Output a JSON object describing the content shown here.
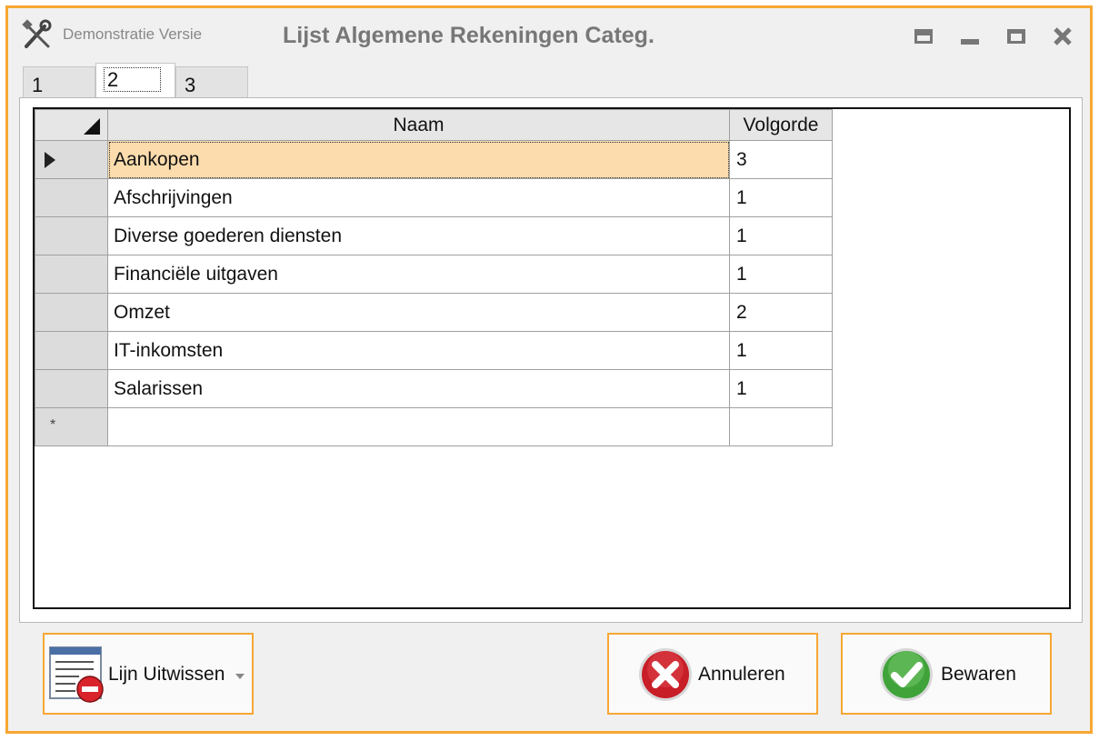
{
  "window": {
    "demo_label": "Demonstratie Versie",
    "title": "Lijst Algemene Rekeningen Categ."
  },
  "tabs": [
    {
      "label": "1"
    },
    {
      "label": "2",
      "active": true
    },
    {
      "label": "3"
    }
  ],
  "grid": {
    "columns": [
      "Naam",
      "Volgorde"
    ],
    "rows": [
      {
        "name": "Aankopen",
        "order": "3",
        "selected": true
      },
      {
        "name": "Afschrijvingen",
        "order": "1"
      },
      {
        "name": "Diverse goederen diensten",
        "order": "1"
      },
      {
        "name": "Financiële uitgaven",
        "order": "1"
      },
      {
        "name": "Omzet",
        "order": "2"
      },
      {
        "name": "IT-inkomsten",
        "order": "1"
      },
      {
        "name": "Salarissen",
        "order": "1"
      }
    ],
    "new_row_marker": "*"
  },
  "footer": {
    "delete_line_label": "Lijn Uitwissen",
    "cancel_label": "Annuleren",
    "save_label": "Bewaren"
  },
  "colors": {
    "accent_border": "#f7a733",
    "selected_cell": "#fcdcad"
  },
  "icons": {
    "app": "tools-icon",
    "delete_line": "list-remove-icon",
    "cancel": "red-x-circle-icon",
    "save": "green-check-circle-icon"
  }
}
